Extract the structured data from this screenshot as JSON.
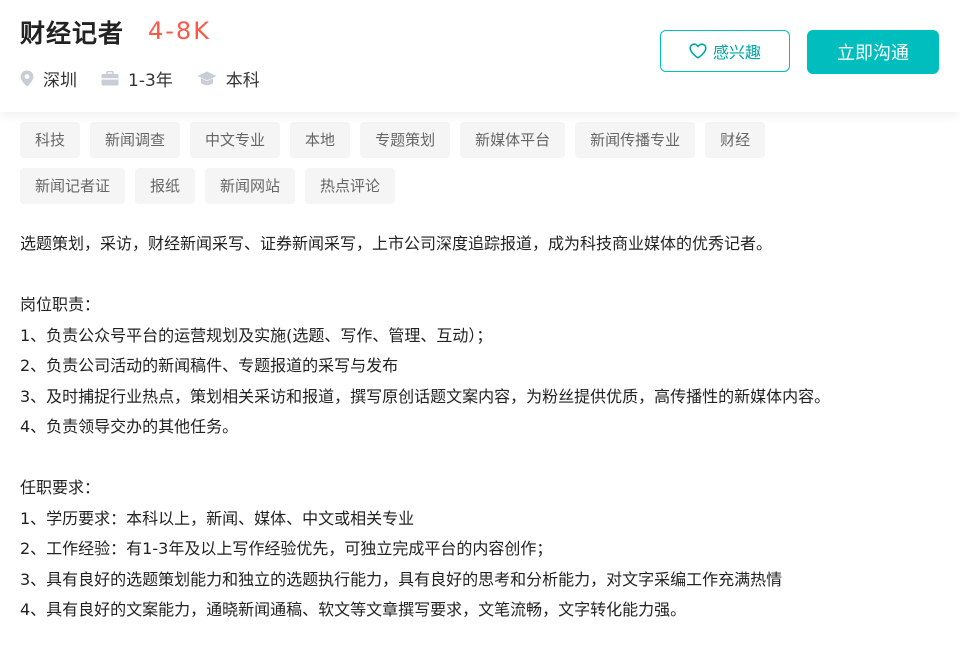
{
  "job": {
    "title": "财经记者",
    "salary": "4-8K",
    "location": "深圳",
    "experience": "1-3年",
    "education": "本科"
  },
  "icons": {
    "location": "location-pin-icon",
    "experience": "briefcase-icon",
    "education": "graduation-cap-icon",
    "interest": "heart-outline-icon"
  },
  "actions": {
    "interest_label": "感兴趣",
    "chat_label": "立即沟通"
  },
  "colors": {
    "accent": "#00bebd",
    "salary": "#fe574a",
    "tag_bg": "#f5f5f5"
  },
  "tags": [
    "科技",
    "新闻调查",
    "中文专业",
    "本地",
    "专题策划",
    "新媒体平台",
    "新闻传播专业",
    "财经",
    "新闻记者证",
    "报纸",
    "新闻网站",
    "热点评论"
  ],
  "description": {
    "intro": "选题策划，采访，财经新闻采写、证券新闻采写，上市公司深度追踪报道，成为科技商业媒体的优秀记者。",
    "duties_title": "岗位职责：",
    "duties": [
      "1、负责公众号平台的运营规划及实施(选题、写作、管理、互动）；",
      "2、负责公司活动的新闻稿件、专题报道的采写与发布",
      "3、及时捕捉行业热点，策划相关采访和报道，撰写原创话题文案内容，为粉丝提供优质，高传播性的新媒体内容。",
      "4、负责领导交办的其他任务。"
    ],
    "requirements_title": "任职要求：",
    "requirements": [
      "1、学历要求：本科以上，新闻、媒体、中文或相关专业",
      "2、工作经验：有1-3年及以上写作经验优先，可独立完成平台的内容创作；",
      "3、具有良好的选题策划能力和独立的选题执行能力，具有良好的思考和分析能力，对文字采编工作充满热情",
      "4、具有良好的文案能力，通晓新闻通稿、软文等文章撰写要求，文笔流畅，文字转化能力强。"
    ]
  }
}
